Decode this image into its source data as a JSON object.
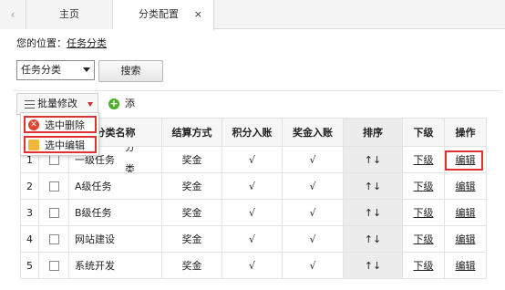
{
  "tabbar": {
    "scroll_left": "‹",
    "tabs": [
      {
        "label": "主页"
      },
      {
        "label": "分类配置",
        "close": "×"
      }
    ]
  },
  "breadcrumb": {
    "prefix": "您的位置：",
    "current": "任务分类"
  },
  "search": {
    "select_value": "任务分类",
    "search_label": "搜索"
  },
  "toolbar": {
    "batch_label": "批量修改",
    "add_label": "添加分类"
  },
  "dropdown": {
    "delete_label": "选中删除",
    "edit_label": "选中编辑"
  },
  "table": {
    "headers": [
      "",
      "",
      "分类名称",
      "结算方式",
      "积分入账",
      "奖金入账",
      "排序",
      "下级",
      "操作"
    ],
    "rows": [
      {
        "no": "1",
        "name": "一级任务",
        "settle": "奖金",
        "points": "√",
        "bonus": "√",
        "sort": "↑↓",
        "sub": "下级",
        "op": "编辑"
      },
      {
        "no": "2",
        "name": "A级任务",
        "settle": "奖金",
        "points": "√",
        "bonus": "√",
        "sort": "↑↓",
        "sub": "下级",
        "op": "编辑"
      },
      {
        "no": "3",
        "name": "B级任务",
        "settle": "奖金",
        "points": "√",
        "bonus": "√",
        "sort": "↑↓",
        "sub": "下级",
        "op": "编辑"
      },
      {
        "no": "4",
        "name": "网站建设",
        "settle": "奖金",
        "points": "√",
        "bonus": "√",
        "sort": "↑↓",
        "sub": "下级",
        "op": "编辑"
      },
      {
        "no": "5",
        "name": "系统开发",
        "settle": "奖金",
        "points": "√",
        "bonus": "√",
        "sort": "↑↓",
        "sub": "下级",
        "op": "编辑"
      }
    ]
  },
  "colors": {
    "highlight": "#e03232",
    "add_icon": "#4caf2a",
    "caret": "#d12e2e"
  }
}
